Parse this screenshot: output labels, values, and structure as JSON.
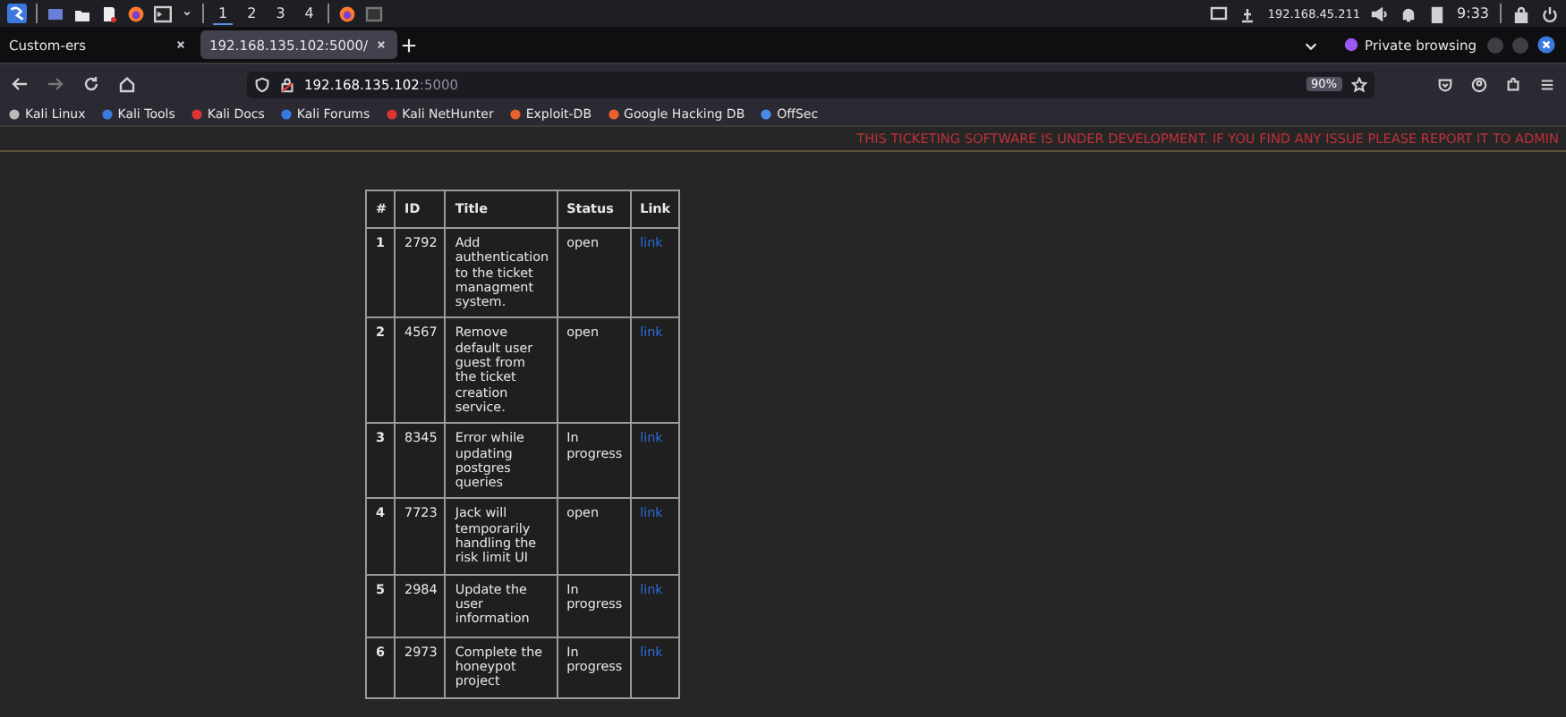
{
  "panel": {
    "workspaces": [
      {
        "label": "1",
        "selected": true
      },
      {
        "label": "2",
        "selected": false
      },
      {
        "label": "3",
        "selected": false
      },
      {
        "label": "4",
        "selected": false
      }
    ],
    "ip": "192.168.45.211",
    "clock": "9:33"
  },
  "tabs": [
    {
      "label": "Custom-ers",
      "selected": false
    },
    {
      "label": "192.168.135.102:5000/",
      "selected": true
    }
  ],
  "private_label": "Private browsing",
  "address": {
    "host": "192.168.135.102",
    "port": ":5000"
  },
  "zoom": "90%",
  "bookmarks": [
    "Kali Linux",
    "Kali Tools",
    "Kali Docs",
    "Kali Forums",
    "Kali NetHunter",
    "Exploit-DB",
    "Google Hacking DB",
    "OffSec"
  ],
  "banner": "THIS TICKETING SOFTWARE IS UNDER DEVELOPMENT. IF YOU FIND ANY ISSUE PLEASE REPORT IT TO ADMIN",
  "table": {
    "columns": [
      "#",
      "ID",
      "Title",
      "Status",
      "Link"
    ],
    "rows": [
      {
        "num": "1",
        "id": "2792",
        "title": "Add authentication to the ticket managment system.",
        "status": "open",
        "link": "link"
      },
      {
        "num": "2",
        "id": "4567",
        "title": "Remove default user guest from the ticket creation service.",
        "status": "open",
        "link": "link"
      },
      {
        "num": "3",
        "id": "8345",
        "title": "Error while updating postgres queries",
        "status": "In progress",
        "link": "link"
      },
      {
        "num": "4",
        "id": "7723",
        "title": "Jack will temporarily handling the risk limit UI",
        "status": "open",
        "link": "link"
      },
      {
        "num": "5",
        "id": "2984",
        "title": "Update the user information",
        "status": "In progress",
        "link": "link"
      },
      {
        "num": "6",
        "id": "2973",
        "title": "Complete the honeypot project",
        "status": "In progress",
        "link": "link"
      }
    ]
  }
}
